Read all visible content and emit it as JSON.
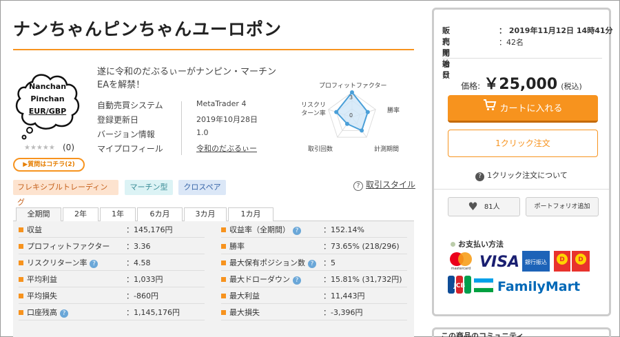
{
  "product": {
    "title": "ナンちゃんピンちゃんユーロポン",
    "logo_lines": [
      "Nanchan",
      "Pinchan",
      "EUR/GBP"
    ],
    "rating_count": "(0)",
    "question_button": "▶質問はコチラ(2)",
    "description": "遂に令和のだぶるぃーがナンピン・マーチンEAを解禁！",
    "info": [
      {
        "label": "自動売買システム",
        "value": "MetaTrader 4"
      },
      {
        "label": "登録更新日",
        "value": "2019年10月28日"
      },
      {
        "label": "バージョン情報",
        "value": "1.0"
      },
      {
        "label": "マイプロフィール",
        "value": "令和のだぶるぃー"
      }
    ],
    "tags": [
      "フレキシブルトレーディング",
      "マーチン型",
      "クロスペア"
    ],
    "style_link": "取引スタイル"
  },
  "radar": {
    "labels": [
      "プロフィットファクター",
      "勝率",
      "計測期間",
      "取引回数",
      "リスクリターン率"
    ],
    "values": [
      3,
      2,
      2,
      1,
      2
    ],
    "scale_labels": [
      "3",
      "0"
    ],
    "colors": {
      "line": "#4a9fd8",
      "fill": "#cfe6f7",
      "grid": "#ddd"
    }
  },
  "tabs": [
    "全期間",
    "2年",
    "1年",
    "6カ月",
    "3カ月",
    "1カ月"
  ],
  "stats": {
    "left": [
      {
        "label": "収益",
        "value": "：145,176円",
        "help": false
      },
      {
        "label": "プロフィットファクター",
        "value": "：3.36",
        "help": false
      },
      {
        "label": "リスクリターン率",
        "value": "：4.58",
        "help": true
      },
      {
        "label": "平均利益",
        "value": "：1,033円",
        "help": false
      },
      {
        "label": "平均損失",
        "value": "：-860円",
        "help": false
      },
      {
        "label": "口座残高",
        "value": "：1,145,176円",
        "help": true
      }
    ],
    "right": [
      {
        "label": "収益率（全期間）",
        "value": "：152.14%",
        "help": true
      },
      {
        "label": "勝率",
        "value": "：73.65% (218/296)",
        "help": false
      },
      {
        "label": "最大保有ポジション数",
        "value": "：5",
        "help": true
      },
      {
        "label": "最大ドローダウン",
        "value": "：15.81% (31,732円)",
        "help": true
      },
      {
        "label": "最大利益",
        "value": "：11,443円",
        "help": false
      },
      {
        "label": "最大損失",
        "value": "：-3,396円",
        "help": false
      }
    ]
  },
  "sidebar": {
    "sale_start_label": "販売開始日",
    "sale_start_value": "：  2019年11月12日 14時41分",
    "users_label": "利用者数",
    "users_value": "：42名",
    "price_label": "価格:",
    "price_value": "￥25,000",
    "price_tax": "(税込)",
    "cart_button": "カートに入れる",
    "oneclick_button": "1クリック注文",
    "about_oneclick": "1クリック注文について",
    "likes": "81人",
    "portfolio_button": "ポートフォリオ追加",
    "payment_title": "お支払い方法",
    "community_title": "この商品のコミュニティ",
    "accent_color": "#f7931e"
  }
}
